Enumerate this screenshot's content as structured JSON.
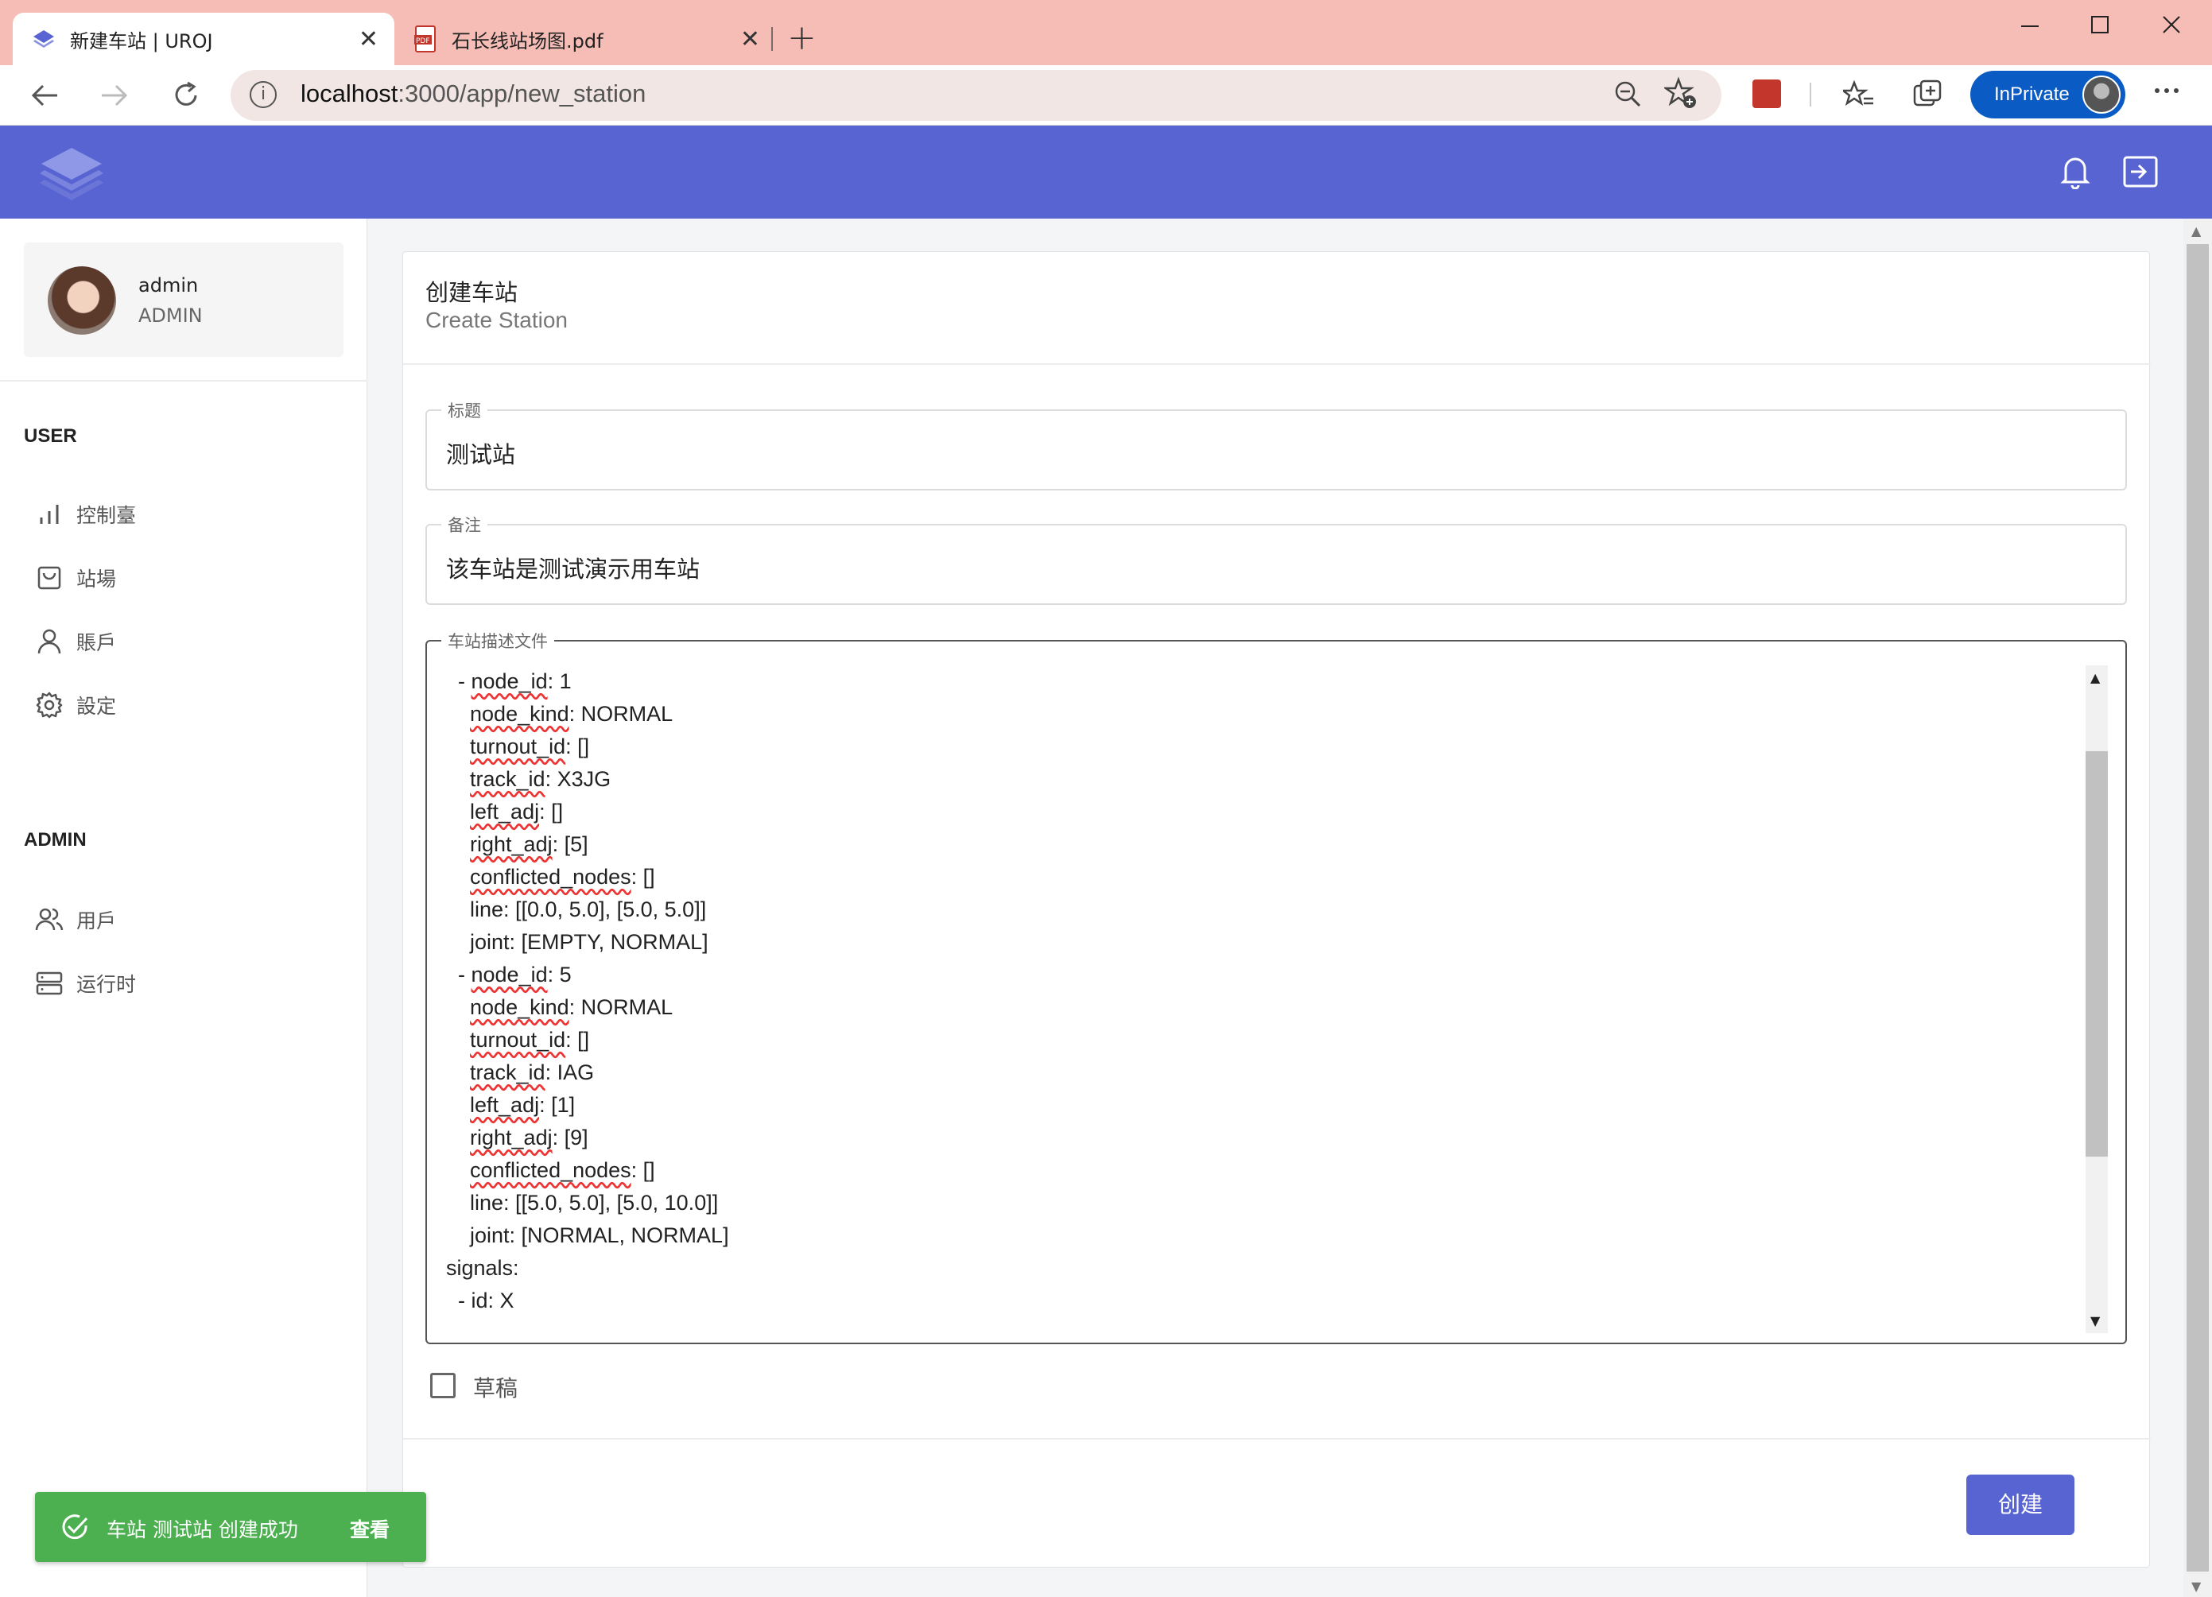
{
  "browser": {
    "tabs": [
      {
        "title": "新建车站 | UROJ",
        "icon": "app-layers-icon",
        "active": true
      },
      {
        "title": "石长线站场图.pdf",
        "icon": "pdf-icon",
        "active": false
      }
    ],
    "url_host": "localhost",
    "url_path": ":3000/app/new_station",
    "inprivate_label": "InPrivate",
    "close_glyph": "✕",
    "newtab_glyph": "+"
  },
  "colors": {
    "accent": "#5864d1",
    "toast": "#4caf50",
    "tabbar": "#f6bdb6"
  },
  "user": {
    "name": "admin",
    "role": "ADMIN"
  },
  "sidebar": {
    "user_section": "USER",
    "user_items": [
      {
        "label": "控制臺",
        "icon": "bar-chart-icon"
      },
      {
        "label": "站場",
        "icon": "shopping-bag-icon"
      },
      {
        "label": "賬戶",
        "icon": "user-icon"
      },
      {
        "label": "設定",
        "icon": "gear-icon"
      }
    ],
    "admin_section": "ADMIN",
    "admin_items": [
      {
        "label": "用戶",
        "icon": "users-icon"
      },
      {
        "label": "运行时",
        "icon": "server-icon"
      }
    ]
  },
  "form": {
    "title": "创建车站",
    "subtitle": "Create Station",
    "title_field": {
      "label": "标题",
      "value": "测试站"
    },
    "note_field": {
      "label": "备注",
      "value": "该车站是测试演示用车站"
    },
    "file_field": {
      "label": "车站描述文件",
      "lines": [
        "  - node_id: 1",
        "    node_kind: NORMAL",
        "    turnout_id: []",
        "    track_id: X3JG",
        "    left_adj: []",
        "    right_adj: [5]",
        "    conflicted_nodes: []",
        "    line: [[0.0, 5.0], [5.0, 5.0]]",
        "    joint: [EMPTY, NORMAL]",
        "  - node_id: 5",
        "    node_kind: NORMAL",
        "    turnout_id: []",
        "    track_id: IAG",
        "    left_adj: [1]",
        "    right_adj: [9]",
        "    conflicted_nodes: []",
        "    line: [[5.0, 5.0], [5.0, 10.0]]",
        "    joint: [NORMAL, NORMAL]",
        "signals:",
        "  - id: X"
      ]
    },
    "draft_label": "草稿",
    "draft_checked": false,
    "submit_label": "创建"
  },
  "toast": {
    "message": "车站 测试站 创建成功",
    "action": "查看"
  }
}
